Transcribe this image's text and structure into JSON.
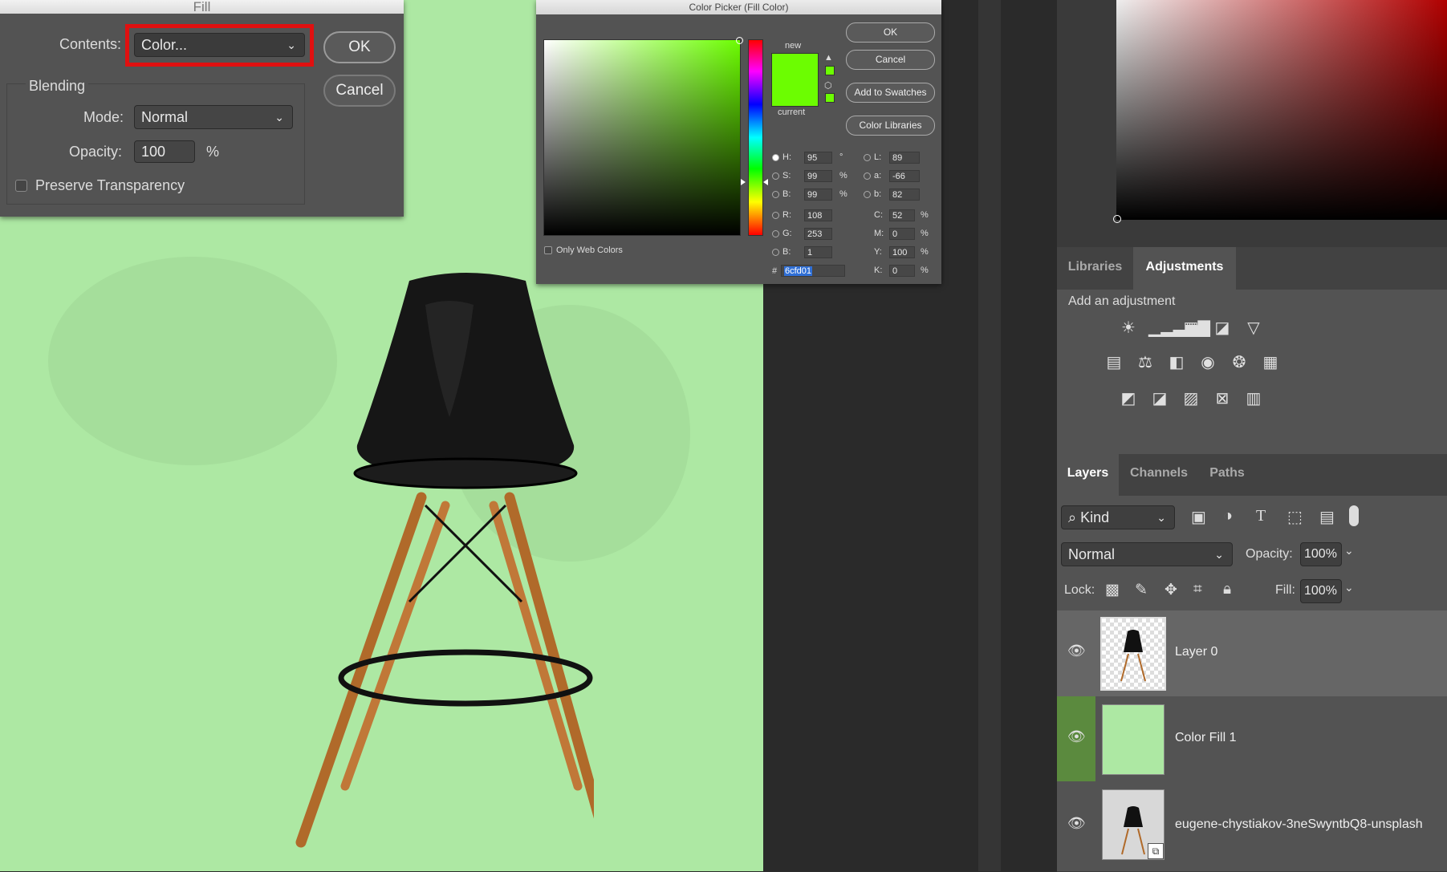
{
  "fill_dialog": {
    "title": "Fill",
    "contents_label": "Contents:",
    "contents_value": "Color...",
    "ok": "OK",
    "cancel": "Cancel",
    "blending_label": "Blending",
    "mode_label": "Mode:",
    "mode_value": "Normal",
    "opacity_label": "Opacity:",
    "opacity_value": "100",
    "opacity_unit": "%",
    "preserve_label": "Preserve Transparency"
  },
  "color_picker": {
    "title": "Color Picker (Fill Color)",
    "new_label": "new",
    "current_label": "current",
    "new_color": "#6cfd01",
    "ok": "OK",
    "cancel": "Cancel",
    "add_swatches": "Add to Swatches",
    "color_libraries": "Color Libraries",
    "only_web": "Only Web Colors",
    "hsb": [
      {
        "k": "H:",
        "v": "95",
        "u": "°"
      },
      {
        "k": "S:",
        "v": "99",
        "u": "%"
      },
      {
        "k": "B:",
        "v": "99",
        "u": "%"
      }
    ],
    "rgb": [
      {
        "k": "R:",
        "v": "108"
      },
      {
        "k": "G:",
        "v": "253"
      },
      {
        "k": "B:",
        "v": "1"
      }
    ],
    "lab": [
      {
        "k": "L:",
        "v": "89"
      },
      {
        "k": "a:",
        "v": "-66"
      },
      {
        "k": "b:",
        "v": "82"
      }
    ],
    "cmyk": [
      {
        "k": "C:",
        "v": "52",
        "u": "%"
      },
      {
        "k": "M:",
        "v": "0",
        "u": "%"
      },
      {
        "k": "Y:",
        "v": "100",
        "u": "%"
      },
      {
        "k": "K:",
        "v": "0",
        "u": "%"
      }
    ],
    "hex_label": "#",
    "hex_value": "6cfd01"
  },
  "adjust_panel": {
    "tabs": [
      "Libraries",
      "Adjustments"
    ],
    "active_tab": "Adjustments",
    "heading": "Add an adjustment"
  },
  "layers_panel": {
    "tabs": [
      "Layers",
      "Channels",
      "Paths"
    ],
    "kind_label": "Kind",
    "blend_mode": "Normal",
    "opacity_label": "Opacity:",
    "opacity_value": "100%",
    "lock_label": "Lock:",
    "fill_label": "Fill:",
    "fill_value": "100%",
    "layers": [
      {
        "name": "Layer 0"
      },
      {
        "name": "Color Fill 1"
      },
      {
        "name": "eugene-chystiakov-3neSwyntbQ8-unsplash"
      }
    ]
  },
  "colors": {
    "canvas_bg": "#ade8a3",
    "highlight_red": "#e01010",
    "picked": "#6cfd01"
  }
}
